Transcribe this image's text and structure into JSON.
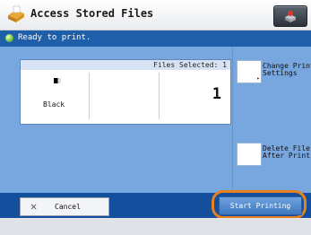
{
  "window": {
    "title": "Access Stored Files",
    "icon": "app-icon",
    "corner_icon": "status-icon"
  },
  "status": {
    "text": "Ready to print.",
    "icon": "ready-indicator-icon",
    "color": "#5fb52e"
  },
  "card": {
    "header": "Files Selected: 1",
    "color_mode": "Black",
    "copies": "1"
  },
  "side_buttons": {
    "change_print": "Change Print\nSettings",
    "delete_file": "Delete File\nAfter Printing"
  },
  "actions": {
    "cancel_label": "Cancel",
    "cancel_icon": "close-icon",
    "start_label": "Start Printing",
    "highlight_color": "#e8801e"
  },
  "colors": {
    "panel": "#78a7e0",
    "statusbar": "#1f5ea8",
    "bottom_strip": "#134f9c"
  }
}
